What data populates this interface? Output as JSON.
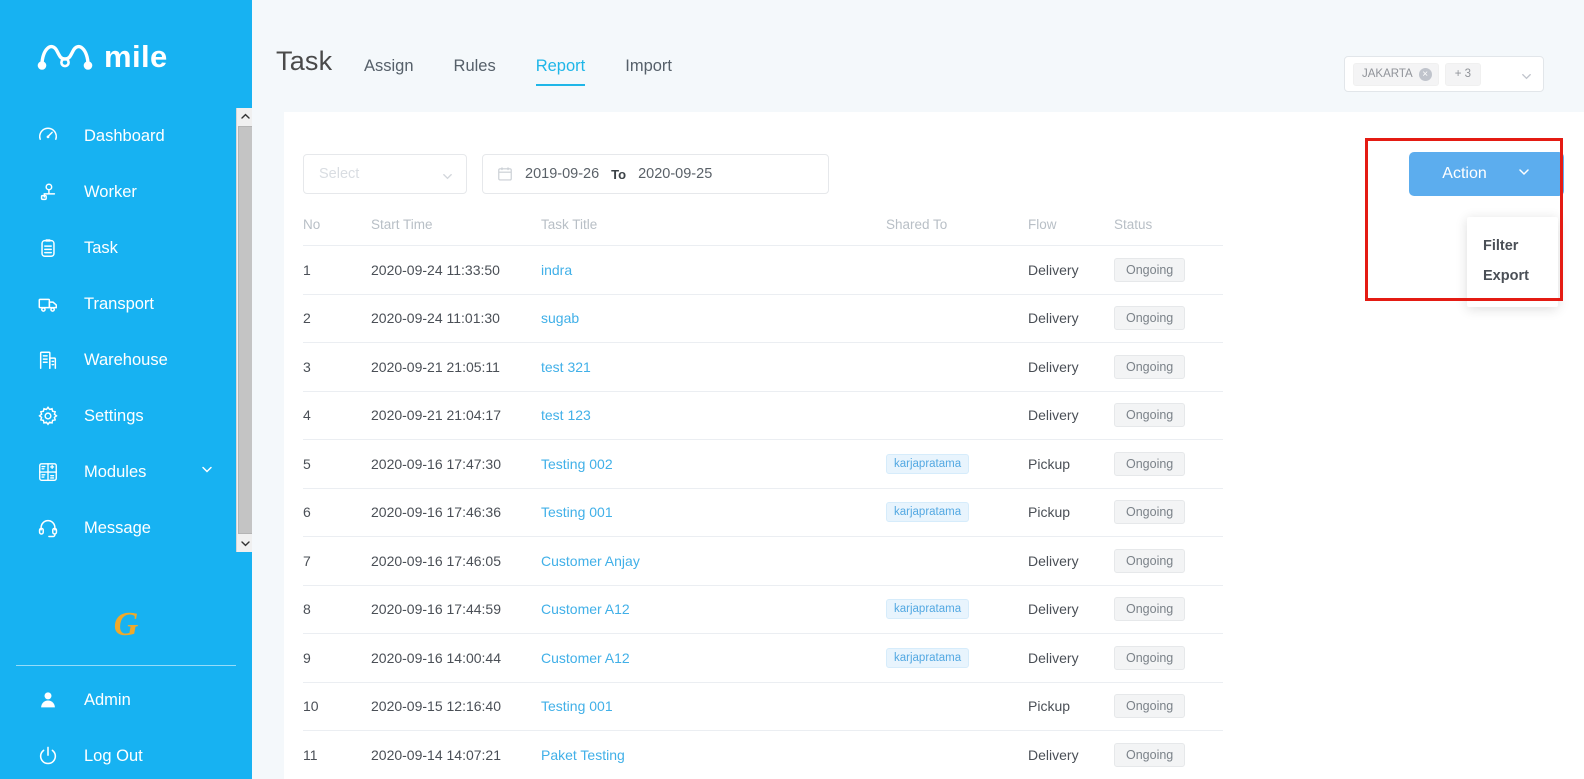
{
  "brand": {
    "logo_text": "mile",
    "logo_icon": "mile-m-logo",
    "footer_mark": "G"
  },
  "sidebar": {
    "items": [
      {
        "label": "Dashboard",
        "icon": "dashboard-icon"
      },
      {
        "label": "Worker",
        "icon": "worker-icon"
      },
      {
        "label": "Task",
        "icon": "task-icon"
      },
      {
        "label": "Transport",
        "icon": "transport-icon"
      },
      {
        "label": "Warehouse",
        "icon": "warehouse-icon"
      },
      {
        "label": "Settings",
        "icon": "gear-icon"
      },
      {
        "label": "Modules",
        "icon": "modules-icon",
        "caret": "chevron-down-icon"
      },
      {
        "label": "Message",
        "icon": "headset-icon"
      }
    ],
    "bottom_items": [
      {
        "label": "Admin",
        "icon": "user-icon"
      },
      {
        "label": "Log Out",
        "icon": "power-icon"
      }
    ]
  },
  "header": {
    "title": "Task",
    "tabs": [
      {
        "label": "Assign",
        "active": false
      },
      {
        "label": "Rules",
        "active": false
      },
      {
        "label": "Report",
        "active": true
      },
      {
        "label": "Import",
        "active": false
      }
    ],
    "region_select": {
      "tag": "JAKARTA",
      "more": "+ 3",
      "close_icon": "close-circle-icon",
      "caret_icon": "chevron-down-icon"
    }
  },
  "filters": {
    "status": {
      "placeholder": "Select",
      "value": "",
      "caret_icon": "chevron-down-icon"
    },
    "date_range": {
      "icon": "calendar-icon",
      "start": "2019-09-26",
      "separator": "To",
      "end": "2020-09-25"
    }
  },
  "action": {
    "button_label": "Action",
    "caret_icon": "chevron-down-icon",
    "menu": [
      {
        "label": "Filter"
      },
      {
        "label": "Export"
      }
    ],
    "highlight_color": "#e41b13"
  },
  "table": {
    "columns": [
      "No",
      "Start Time",
      "Task Title",
      "Shared To",
      "Flow",
      "Status"
    ],
    "rows": [
      {
        "no": "1",
        "time": "2020-09-24 11:33:50",
        "title": "indra",
        "shared": "",
        "flow": "Delivery",
        "status": "Ongoing"
      },
      {
        "no": "2",
        "time": "2020-09-24 11:01:30",
        "title": "sugab",
        "shared": "",
        "flow": "Delivery",
        "status": "Ongoing"
      },
      {
        "no": "3",
        "time": "2020-09-21 21:05:11",
        "title": "test 321",
        "shared": "",
        "flow": "Delivery",
        "status": "Ongoing"
      },
      {
        "no": "4",
        "time": "2020-09-21 21:04:17",
        "title": "test 123",
        "shared": "",
        "flow": "Delivery",
        "status": "Ongoing"
      },
      {
        "no": "5",
        "time": "2020-09-16 17:47:30",
        "title": "Testing 002",
        "shared": "karjapratama",
        "flow": "Pickup",
        "status": "Ongoing"
      },
      {
        "no": "6",
        "time": "2020-09-16 17:46:36",
        "title": "Testing 001",
        "shared": "karjapratama",
        "flow": "Pickup",
        "status": "Ongoing"
      },
      {
        "no": "7",
        "time": "2020-09-16 17:46:05",
        "title": "Customer Anjay",
        "shared": "",
        "flow": "Delivery",
        "status": "Ongoing"
      },
      {
        "no": "8",
        "time": "2020-09-16 17:44:59",
        "title": "Customer A12",
        "shared": "karjapratama",
        "flow": "Delivery",
        "status": "Ongoing"
      },
      {
        "no": "9",
        "time": "2020-09-16 14:00:44",
        "title": "Customer A12",
        "shared": "karjapratama",
        "flow": "Delivery",
        "status": "Ongoing"
      },
      {
        "no": "10",
        "time": "2020-09-15 12:16:40",
        "title": "Testing 001",
        "shared": "",
        "flow": "Pickup",
        "status": "Ongoing"
      },
      {
        "no": "11",
        "time": "2020-09-14 14:07:21",
        "title": "Paket Testing",
        "shared": "",
        "flow": "Delivery",
        "status": "Ongoing"
      }
    ]
  },
  "colors": {
    "sidebar": "#17b2f2",
    "accent": "#1fb6e8",
    "link": "#41b0e8",
    "action_button": "#5cadee",
    "page_bg": "#f4f8fb",
    "brand_mark": "#f0a92a"
  }
}
